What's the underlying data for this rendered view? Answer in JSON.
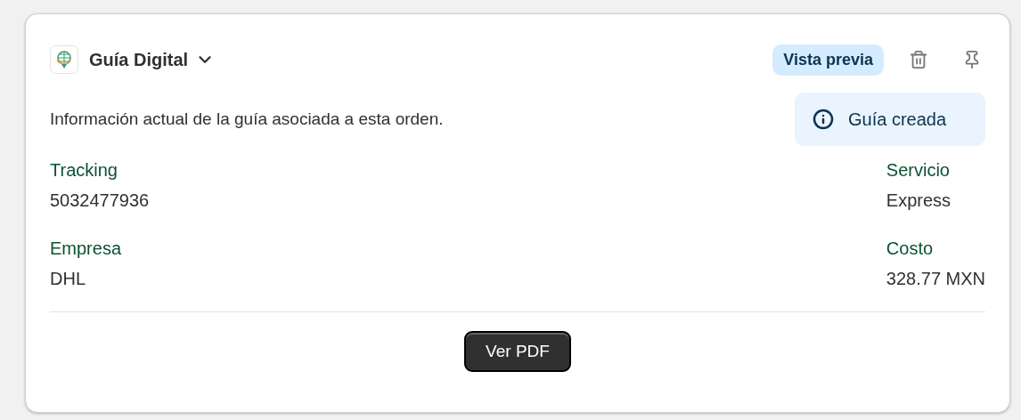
{
  "header": {
    "title": "Guía Digital",
    "badge": "Vista previa"
  },
  "description": "Información actual de la guía asociada a esta orden.",
  "status": {
    "label": "Guía creada"
  },
  "columns": [
    [
      {
        "label": "Tracking",
        "value": "5032477936"
      },
      {
        "label": "Empresa",
        "value": "DHL"
      }
    ],
    [
      {
        "label": "Servicio",
        "value": "Express"
      },
      {
        "label": "Costo",
        "value": "328.77 MXN"
      }
    ]
  ],
  "button": "Ver PDF"
}
